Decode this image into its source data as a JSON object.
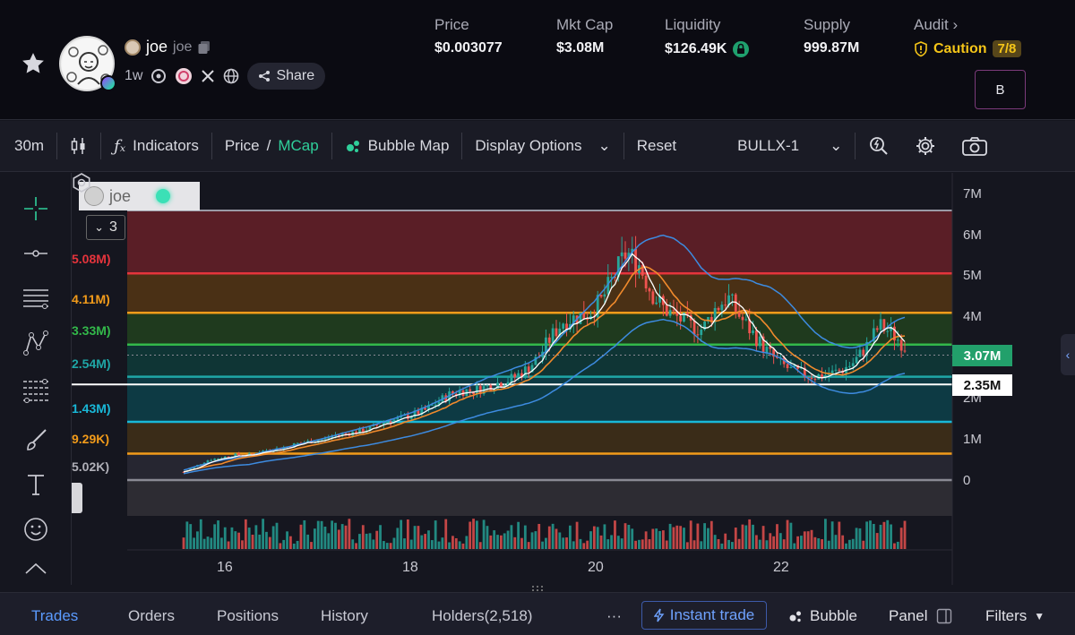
{
  "token": {
    "name": "joe",
    "symbol": "joe",
    "age": "1w",
    "share_label": "Share"
  },
  "stats": {
    "price": {
      "label": "Price",
      "value": "$0.003077"
    },
    "mkt_cap": {
      "label": "Mkt Cap",
      "value": "$3.08M"
    },
    "liquidity": {
      "label": "Liquidity",
      "value": "$126.49K"
    },
    "supply": {
      "label": "Supply",
      "value": "999.87M"
    },
    "audit": {
      "label": "Audit",
      "status": "Caution",
      "score": "7/8"
    }
  },
  "b_button": "B",
  "toolbar": {
    "interval": "30m",
    "indicators": "Indicators",
    "price": "Price",
    "slash": "/",
    "mcap": "MCap",
    "bubble_map": "Bubble Map",
    "display_options": "Display Options",
    "reset": "Reset",
    "preset": "BULLX-1"
  },
  "chart": {
    "legend_name": "joe",
    "collapsed_count": "3",
    "fib_labels": [
      "5.08M)",
      "4.11M)",
      "3.33M)",
      "2.54M)",
      "1.43M)",
      "9.29K)",
      "5.02K)"
    ],
    "current_tag": "3.07M",
    "line_tag": "2.35M",
    "colors": {
      "fib_top": "#5a1e26",
      "red_line": "#e5343c",
      "orange_line": "#f29b1a",
      "green_line": "#33b84a",
      "teal_zone": "#0d3c40",
      "cyan_line": "#19b8d8",
      "up": "#26a69a",
      "down": "#ef5350"
    }
  },
  "chart_data": {
    "type": "candlestick",
    "x_ticks": [
      "16",
      "18",
      "20",
      "22"
    ],
    "y_ticks": [
      "7M",
      "6M",
      "5M",
      "4M",
      "3M",
      "2M",
      "1M",
      "0"
    ],
    "ylim": [
      0,
      7000000
    ],
    "fib_levels": [
      {
        "label": "5.08M",
        "value": 5080000
      },
      {
        "label": "4.11M",
        "value": 4110000
      },
      {
        "label": "3.33M",
        "value": 3330000
      },
      {
        "label": "2.54M",
        "value": 2540000
      },
      {
        "label": "1.43M",
        "value": 1430000
      },
      {
        "label": "9.29K",
        "value": 650000
      },
      {
        "label": "5.02K",
        "value": 0
      }
    ],
    "close_series": [
      0.2,
      0.35,
      0.5,
      0.55,
      0.62,
      0.6,
      0.7,
      0.75,
      0.8,
      0.9,
      0.95,
      1.0,
      1.1,
      1.15,
      1.2,
      1.3,
      1.45,
      1.5,
      1.6,
      1.7,
      1.9,
      2.1,
      2.2,
      2.2,
      2.3,
      2.4,
      2.5,
      2.7,
      3.0,
      3.5,
      3.9,
      4.0,
      4.1,
      4.4,
      5.0,
      5.6,
      5.3,
      4.6,
      4.2,
      4.0,
      3.8,
      3.7,
      4.2,
      4.5,
      4.0,
      3.6,
      3.2,
      2.9,
      2.7,
      2.6,
      2.55,
      2.6,
      2.7,
      2.9,
      3.3,
      3.8,
      3.6,
      3.3
    ]
  },
  "bottom": {
    "tabs": [
      "Trades",
      "Orders",
      "Positions",
      "History",
      "Holders(2,518)"
    ],
    "more": "···",
    "instant_trade": "Instant trade",
    "bubble": "Bubble",
    "panel": "Panel",
    "filters": "Filters"
  }
}
